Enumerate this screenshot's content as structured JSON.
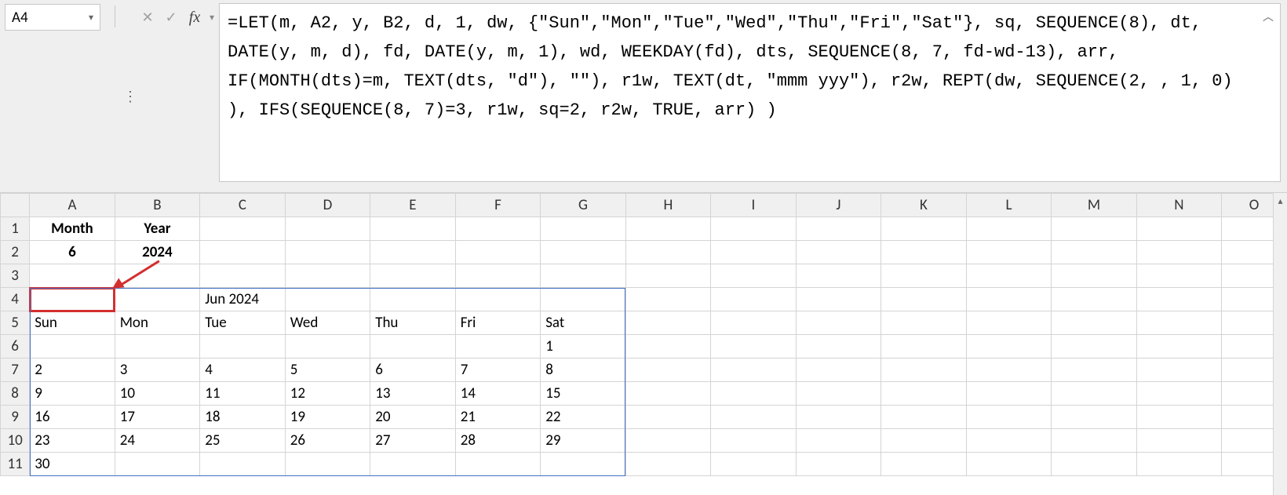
{
  "namebox": {
    "value": "A4"
  },
  "formula_bar": {
    "text": "=LET(m, A2, y, B2, d, 1, dw, {\"Sun\",\"Mon\",\"Tue\",\"Wed\",\"Thu\",\"Fri\",\"Sat\"}, sq, SEQUENCE(8), dt, DATE(y, m, d), fd, DATE(y, m, 1), wd, WEEKDAY(fd), dts, SEQUENCE(8, 7, fd-wd-13), arr, IF(MONTH(dts)=m, TEXT(dts, \"d\"), \"\"), r1w, TEXT(dt, \"mmm yyy\"), r2w, REPT(dw, SEQUENCE(2, , 1, 0) ), IFS(SEQUENCE(8, 7)=3, r1w, sq=2, r2w, TRUE, arr) )"
  },
  "columns": [
    "A",
    "B",
    "C",
    "D",
    "E",
    "F",
    "G",
    "H",
    "I",
    "J",
    "K",
    "L",
    "M",
    "N",
    "O"
  ],
  "row_headers": [
    "1",
    "2",
    "3",
    "4",
    "5",
    "6",
    "7",
    "8",
    "9",
    "10",
    "11"
  ],
  "cells": {
    "A1": "Month",
    "B1": "Year",
    "A2": "6",
    "B2": "2024",
    "C4": "Jun 2024",
    "A5": "Sun",
    "B5": "Mon",
    "C5": "Tue",
    "D5": "Wed",
    "E5": "Thu",
    "F5": "Fri",
    "G5": "Sat",
    "G6": "1",
    "A7": "2",
    "B7": "3",
    "C7": "4",
    "D7": "5",
    "E7": "6",
    "F7": "7",
    "G7": "8",
    "A8": "9",
    "B8": "10",
    "C8": "11",
    "D8": "12",
    "E8": "13",
    "F8": "14",
    "G8": "15",
    "A9": "16",
    "B9": "17",
    "C9": "18",
    "D9": "19",
    "E9": "20",
    "F9": "21",
    "G9": "22",
    "A10": "23",
    "B10": "24",
    "C10": "25",
    "D10": "26",
    "E10": "27",
    "F10": "28",
    "G10": "29",
    "A11": "30"
  },
  "chart_data": {
    "type": "table",
    "title": "Jun 2024",
    "columns": [
      "Sun",
      "Mon",
      "Tue",
      "Wed",
      "Thu",
      "Fri",
      "Sat"
    ],
    "rows": [
      [
        "",
        "",
        "",
        "",
        "",
        "",
        "1"
      ],
      [
        "2",
        "3",
        "4",
        "5",
        "6",
        "7",
        "8"
      ],
      [
        "9",
        "10",
        "11",
        "12",
        "13",
        "14",
        "15"
      ],
      [
        "16",
        "17",
        "18",
        "19",
        "20",
        "21",
        "22"
      ],
      [
        "23",
        "24",
        "25",
        "26",
        "27",
        "28",
        "29"
      ],
      [
        "30",
        "",
        "",
        "",
        "",
        "",
        ""
      ]
    ],
    "inputs": {
      "Month": 6,
      "Year": 2024
    }
  }
}
